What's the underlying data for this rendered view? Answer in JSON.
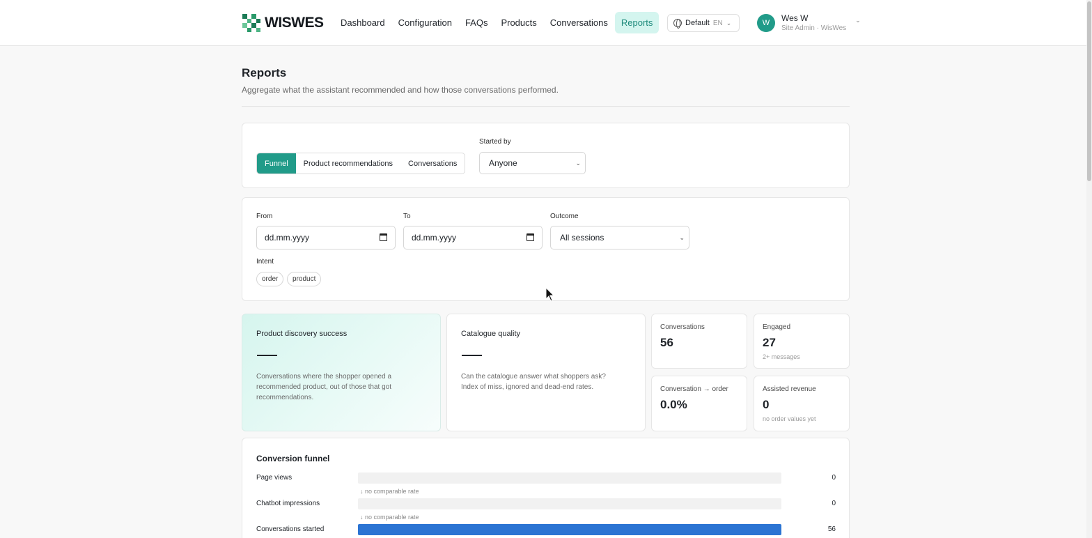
{
  "brand": {
    "name": "WISWES"
  },
  "nav": {
    "items": [
      "Dashboard",
      "Configuration",
      "FAQs",
      "Products",
      "Conversations",
      "Reports"
    ],
    "active": "Reports"
  },
  "language": {
    "label": "Default",
    "code": "EN"
  },
  "user": {
    "initial": "W",
    "name": "Wes W",
    "role": "Site Admin · WisWes"
  },
  "page": {
    "title": "Reports",
    "subtitle": "Aggregate what the assistant recommended and how those conversations performed."
  },
  "report_tabs": {
    "items": [
      "Funnel",
      "Product recommendations",
      "Conversations"
    ],
    "active": "Funnel"
  },
  "started_by": {
    "label": "Started by",
    "value": "Anyone"
  },
  "filters": {
    "from": {
      "label": "From",
      "placeholder": "dd.mm.yyyy"
    },
    "to": {
      "label": "To",
      "placeholder": "dd.mm.yyyy"
    },
    "outcome": {
      "label": "Outcome",
      "value": "All sessions"
    },
    "intent": {
      "label": "Intent",
      "chips": [
        "order",
        "product"
      ]
    }
  },
  "kpis": {
    "discovery": {
      "title": "Product discovery success",
      "value": "—",
      "desc": "Conversations where the shopper opened a recommended product, out of those that got recommendations."
    },
    "catalogue": {
      "title": "Catalogue quality",
      "value": "—",
      "desc": "Can the catalogue answer what shoppers ask? Index of miss, ignored and dead-end rates."
    }
  },
  "stats": {
    "conversations": {
      "label": "Conversations",
      "value": "56"
    },
    "engaged": {
      "label": "Engaged",
      "value": "27",
      "hint": "2+ messages"
    },
    "conv_order": {
      "label": "Conversation → order",
      "value": "0.0%"
    },
    "revenue": {
      "label": "Assisted revenue",
      "value": "0",
      "hint": "no order values yet"
    }
  },
  "funnel": {
    "title": "Conversion funnel",
    "rows": [
      {
        "label": "Page views",
        "count": "0",
        "fraction": 0
      },
      {
        "label": "Chatbot impressions",
        "count": "0",
        "fraction": 0
      },
      {
        "label": "Conversations started",
        "count": "56",
        "fraction": 1.0
      }
    ],
    "rates": [
      "↓ no comparable rate",
      "↓ no comparable rate"
    ]
  },
  "colors": {
    "accent": "#219b89",
    "accent_light": "#d4f5ef",
    "bar": "#2b74d3"
  }
}
